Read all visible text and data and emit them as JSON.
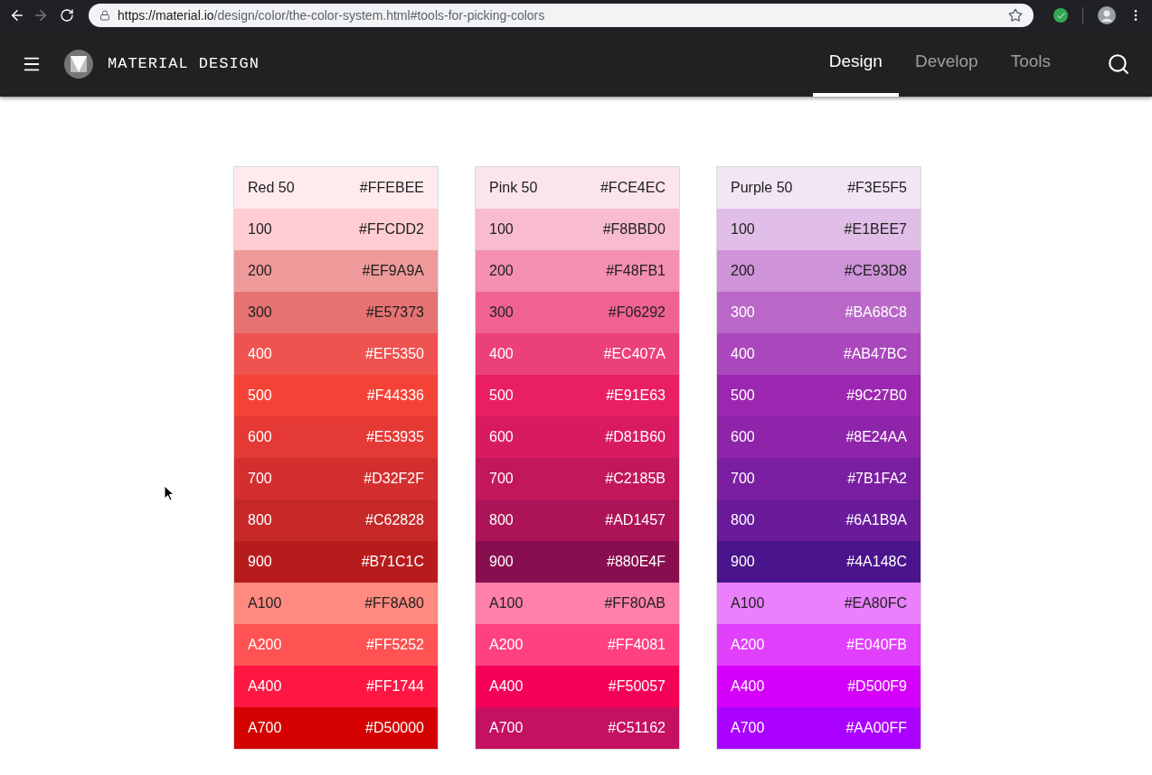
{
  "browser": {
    "url_host": "https://material.io",
    "url_path": "/design/color/the-color-system.html#tools-for-picking-colors",
    "forward_disabled": true
  },
  "header": {
    "title": "MATERIAL DESIGN",
    "tabs": [
      {
        "label": "Design",
        "selected": true
      },
      {
        "label": "Develop",
        "selected": false
      },
      {
        "label": "Tools",
        "selected": false
      }
    ]
  },
  "palettes": [
    {
      "swatches": [
        {
          "name": "Red 50",
          "hex": "#FFEBEE",
          "color": "#ffebee",
          "kind": "dark"
        },
        {
          "name": "100",
          "hex": "#FFCDD2",
          "color": "#ffcdd2",
          "kind": "dark"
        },
        {
          "name": "200",
          "hex": "#EF9A9A",
          "color": "#ef9a9a",
          "kind": "dark"
        },
        {
          "name": "300",
          "hex": "#E57373",
          "color": "#e57373",
          "kind": "dark"
        },
        {
          "name": "400",
          "hex": "#EF5350",
          "color": "#ef5350",
          "kind": "light"
        },
        {
          "name": "500",
          "hex": "#F44336",
          "color": "#f44336",
          "kind": "light"
        },
        {
          "name": "600",
          "hex": "#E53935",
          "color": "#e53935",
          "kind": "light"
        },
        {
          "name": "700",
          "hex": "#D32F2F",
          "color": "#d32f2f",
          "kind": "light"
        },
        {
          "name": "800",
          "hex": "#C62828",
          "color": "#c62828",
          "kind": "light"
        },
        {
          "name": "900",
          "hex": "#B71C1C",
          "color": "#b71c1c",
          "kind": "light"
        },
        {
          "name": "A100",
          "hex": "#FF8A80",
          "color": "#ff8a80",
          "kind": "dark"
        },
        {
          "name": "A200",
          "hex": "#FF5252",
          "color": "#ff5252",
          "kind": "light"
        },
        {
          "name": "A400",
          "hex": "#FF1744",
          "color": "#ff1744",
          "kind": "light"
        },
        {
          "name": "A700",
          "hex": "#D50000",
          "color": "#d50000",
          "kind": "light"
        }
      ]
    },
    {
      "swatches": [
        {
          "name": "Pink 50",
          "hex": "#FCE4EC",
          "color": "#fce4ec",
          "kind": "dark"
        },
        {
          "name": "100",
          "hex": "#F8BBD0",
          "color": "#f8bbd0",
          "kind": "dark"
        },
        {
          "name": "200",
          "hex": "#F48FB1",
          "color": "#f48fb1",
          "kind": "dark"
        },
        {
          "name": "300",
          "hex": "#F06292",
          "color": "#f06292",
          "kind": "dark"
        },
        {
          "name": "400",
          "hex": "#EC407A",
          "color": "#ec407a",
          "kind": "light"
        },
        {
          "name": "500",
          "hex": "#E91E63",
          "color": "#e91e63",
          "kind": "light"
        },
        {
          "name": "600",
          "hex": "#D81B60",
          "color": "#d81b60",
          "kind": "light"
        },
        {
          "name": "700",
          "hex": "#C2185B",
          "color": "#c2185b",
          "kind": "light"
        },
        {
          "name": "800",
          "hex": "#AD1457",
          "color": "#ad1457",
          "kind": "light"
        },
        {
          "name": "900",
          "hex": "#880E4F",
          "color": "#880e4f",
          "kind": "light"
        },
        {
          "name": "A100",
          "hex": "#FF80AB",
          "color": "#ff80ab",
          "kind": "dark"
        },
        {
          "name": "A200",
          "hex": "#FF4081",
          "color": "#ff4081",
          "kind": "light"
        },
        {
          "name": "A400",
          "hex": "#F50057",
          "color": "#f50057",
          "kind": "light"
        },
        {
          "name": "A700",
          "hex": "#C51162",
          "color": "#c51162",
          "kind": "light"
        }
      ]
    },
    {
      "swatches": [
        {
          "name": "Purple 50",
          "hex": "#F3E5F5",
          "color": "#f3e5f5",
          "kind": "dark"
        },
        {
          "name": "100",
          "hex": "#E1BEE7",
          "color": "#e1bee7",
          "kind": "dark"
        },
        {
          "name": "200",
          "hex": "#CE93D8",
          "color": "#ce93d8",
          "kind": "dark"
        },
        {
          "name": "300",
          "hex": "#BA68C8",
          "color": "#ba68c8",
          "kind": "light"
        },
        {
          "name": "400",
          "hex": "#AB47BC",
          "color": "#ab47bc",
          "kind": "light"
        },
        {
          "name": "500",
          "hex": "#9C27B0",
          "color": "#9c27b0",
          "kind": "light"
        },
        {
          "name": "600",
          "hex": "#8E24AA",
          "color": "#8e24aa",
          "kind": "light"
        },
        {
          "name": "700",
          "hex": "#7B1FA2",
          "color": "#7b1fa2",
          "kind": "light"
        },
        {
          "name": "800",
          "hex": "#6A1B9A",
          "color": "#6a1b9a",
          "kind": "light"
        },
        {
          "name": "900",
          "hex": "#4A148C",
          "color": "#4a148c",
          "kind": "light"
        },
        {
          "name": "A100",
          "hex": "#EA80FC",
          "color": "#ea80fc",
          "kind": "dark"
        },
        {
          "name": "A200",
          "hex": "#E040FB",
          "color": "#e040fb",
          "kind": "light"
        },
        {
          "name": "A400",
          "hex": "#D500F9",
          "color": "#d500f9",
          "kind": "light"
        },
        {
          "name": "A700",
          "hex": "#AA00FF",
          "color": "#aa00ff",
          "kind": "light"
        }
      ]
    }
  ]
}
